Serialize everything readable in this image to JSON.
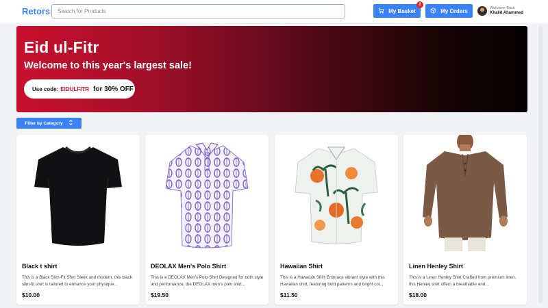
{
  "header": {
    "logo": "Retors",
    "search_placeholder": "Search for Products",
    "basket_label": "My Basket",
    "basket_count": "2",
    "orders_label": "My Orders",
    "welcome": "Welcome Back",
    "username": "Khalid Ahammed"
  },
  "banner": {
    "title": "Eid ul-Fitr",
    "subtitle": "Welcome to this year's largest sale!",
    "use_code_label": "Use code:",
    "code": "EIDULFITR",
    "discount_text": "for 30% OFF",
    "colors": {
      "start": "#c8102e",
      "end": "#050102"
    }
  },
  "filter": {
    "label": "Filter by Category"
  },
  "products": [
    {
      "name": "Black t shirt",
      "description": "This is a Black Slim-Fit Shirt Sleek and modern, this black slim-fit shirt is tailored to enhance your physique...",
      "price": "$10.00",
      "icon": "black-tshirt"
    },
    {
      "name": "DEOLAX Men's Polo Shirt",
      "description": "This is a DEOLAX Men's Polo Shirt Designed for both style and performance, the DEOLAX men's polo shirt...",
      "price": "$19.50",
      "icon": "purple-polo-shirt"
    },
    {
      "name": "Hawaiian Shirt",
      "description": "This is a Hawaiian Shirt Embrace vibrant style with this Hawaiian shirt, featuring bold patterns and bright col...",
      "price": "$11.50",
      "icon": "hawaiian-shirt"
    },
    {
      "name": "Linen Henley Shirt",
      "description": "This is a Linen Henley Shirt Crafted from premium linen, this Henley shirt offers a breathable and...",
      "price": "$18.00",
      "icon": "linen-henley-shirt"
    }
  ],
  "colors": {
    "accent": "#3b82f6",
    "badge": "#dc2626"
  }
}
